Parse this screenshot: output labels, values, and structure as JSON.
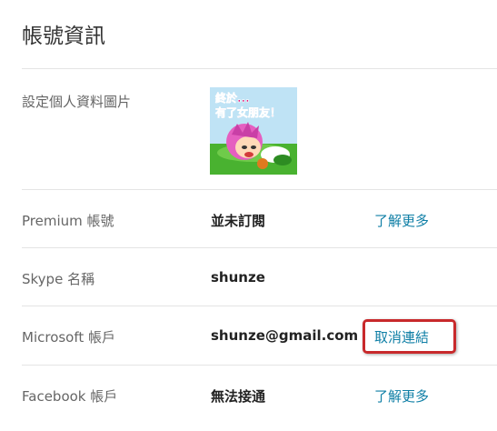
{
  "page": {
    "title": "帳號資訊"
  },
  "profile_picture": {
    "label": "設定個人資料圖片",
    "caption_line1": "終於...",
    "caption_line2": "有了女朋友！"
  },
  "rows": [
    {
      "label": "Premium 帳號",
      "value": "並未訂閱",
      "link": "了解更多"
    },
    {
      "label": "Skype 名稱",
      "value": "shunze",
      "link": ""
    },
    {
      "label": "Microsoft 帳戶",
      "value": "shunze@gmail.com",
      "link": "取消連結"
    },
    {
      "label": "Facebook 帳戶",
      "value": "無法接通",
      "link": "了解更多"
    }
  ],
  "colors": {
    "link": "#0f7fa6",
    "highlight": "#c8292b",
    "divider": "#e4e4e4"
  }
}
